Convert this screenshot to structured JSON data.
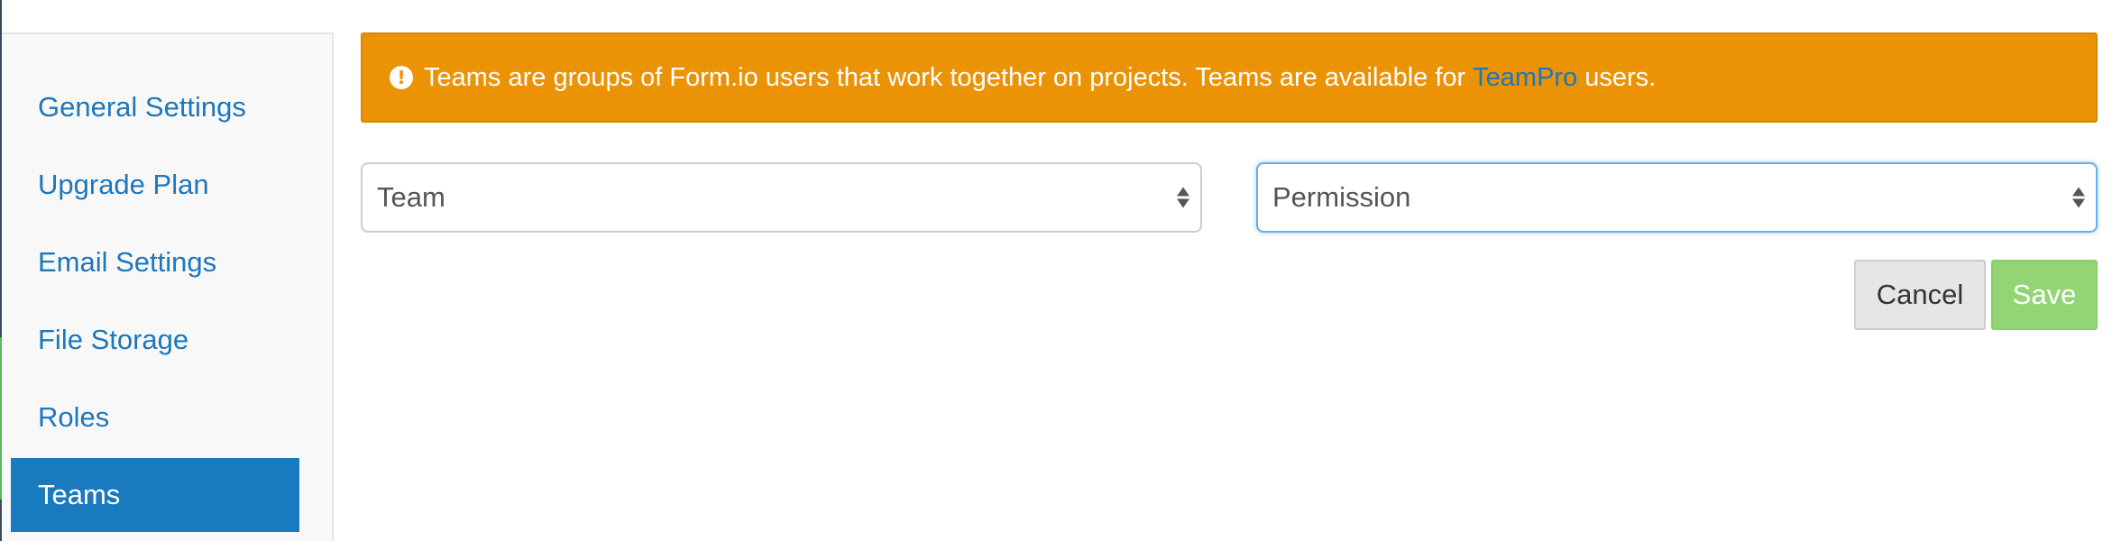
{
  "sidebar": {
    "items": [
      {
        "label": "General Settings",
        "active": false
      },
      {
        "label": "Upgrade Plan",
        "active": false
      },
      {
        "label": "Email Settings",
        "active": false
      },
      {
        "label": "File Storage",
        "active": false
      },
      {
        "label": "Roles",
        "active": false
      },
      {
        "label": "Teams",
        "active": true
      }
    ]
  },
  "alert": {
    "icon": "exclamation-circle-icon",
    "text_before": "Teams are groups of Form.io users that work together on projects. Teams are available for",
    "link": "TeamPro",
    "text_after": "users."
  },
  "form": {
    "team_select": {
      "value": "Team"
    },
    "permission_select": {
      "value": "Permission"
    },
    "cancel_label": "Cancel",
    "save_label": "Save"
  },
  "colors": {
    "accent": "#1a7abf",
    "link": "#1c77bc",
    "warning": "#eb9205",
    "save": "#93d575"
  }
}
